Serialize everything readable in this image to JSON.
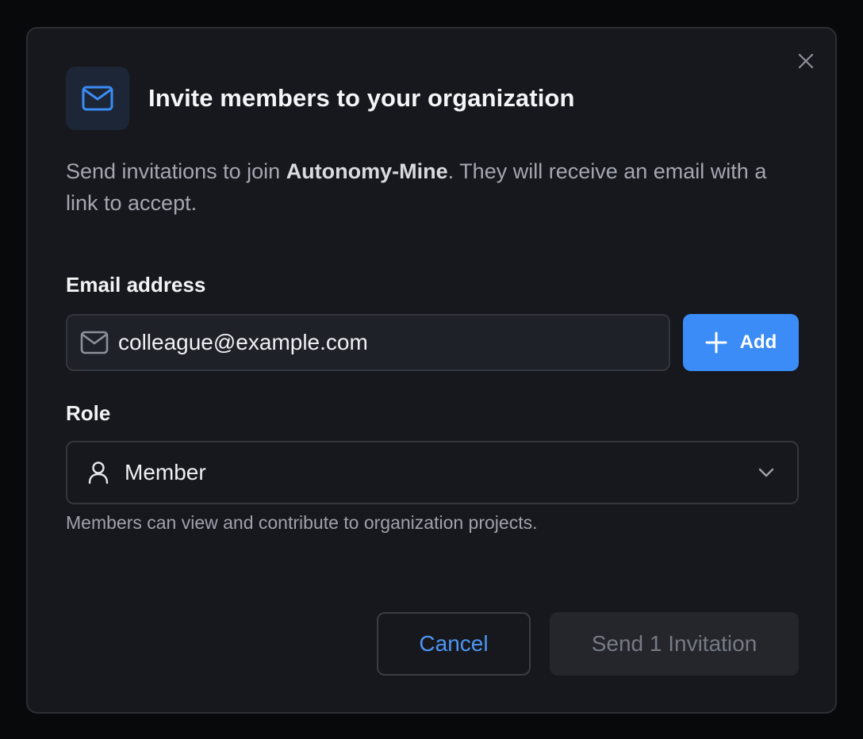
{
  "dialog": {
    "title": "Invite members to your organization",
    "description_prefix": "Send invitations to join ",
    "org_name": "Autonomy-Mine",
    "description_suffix": ". They will receive an email with a link to accept.",
    "header_icon": "mail-icon",
    "close_icon": "close-icon"
  },
  "email": {
    "label": "Email address",
    "value": "colleague@example.com",
    "placeholder": "colleague@example.com",
    "icon": "mail-icon",
    "add_label": "Add",
    "add_icon": "plus-icon"
  },
  "role": {
    "label": "Role",
    "selected": "Member",
    "icon": "user-icon",
    "hint": "Members can view and contribute to organization projects."
  },
  "actions": {
    "cancel_label": "Cancel",
    "send_label": "Send 1 Invitation"
  },
  "colors": {
    "accent": "#3b8cf6",
    "background": "#17181d",
    "overlay": "#08090b"
  }
}
